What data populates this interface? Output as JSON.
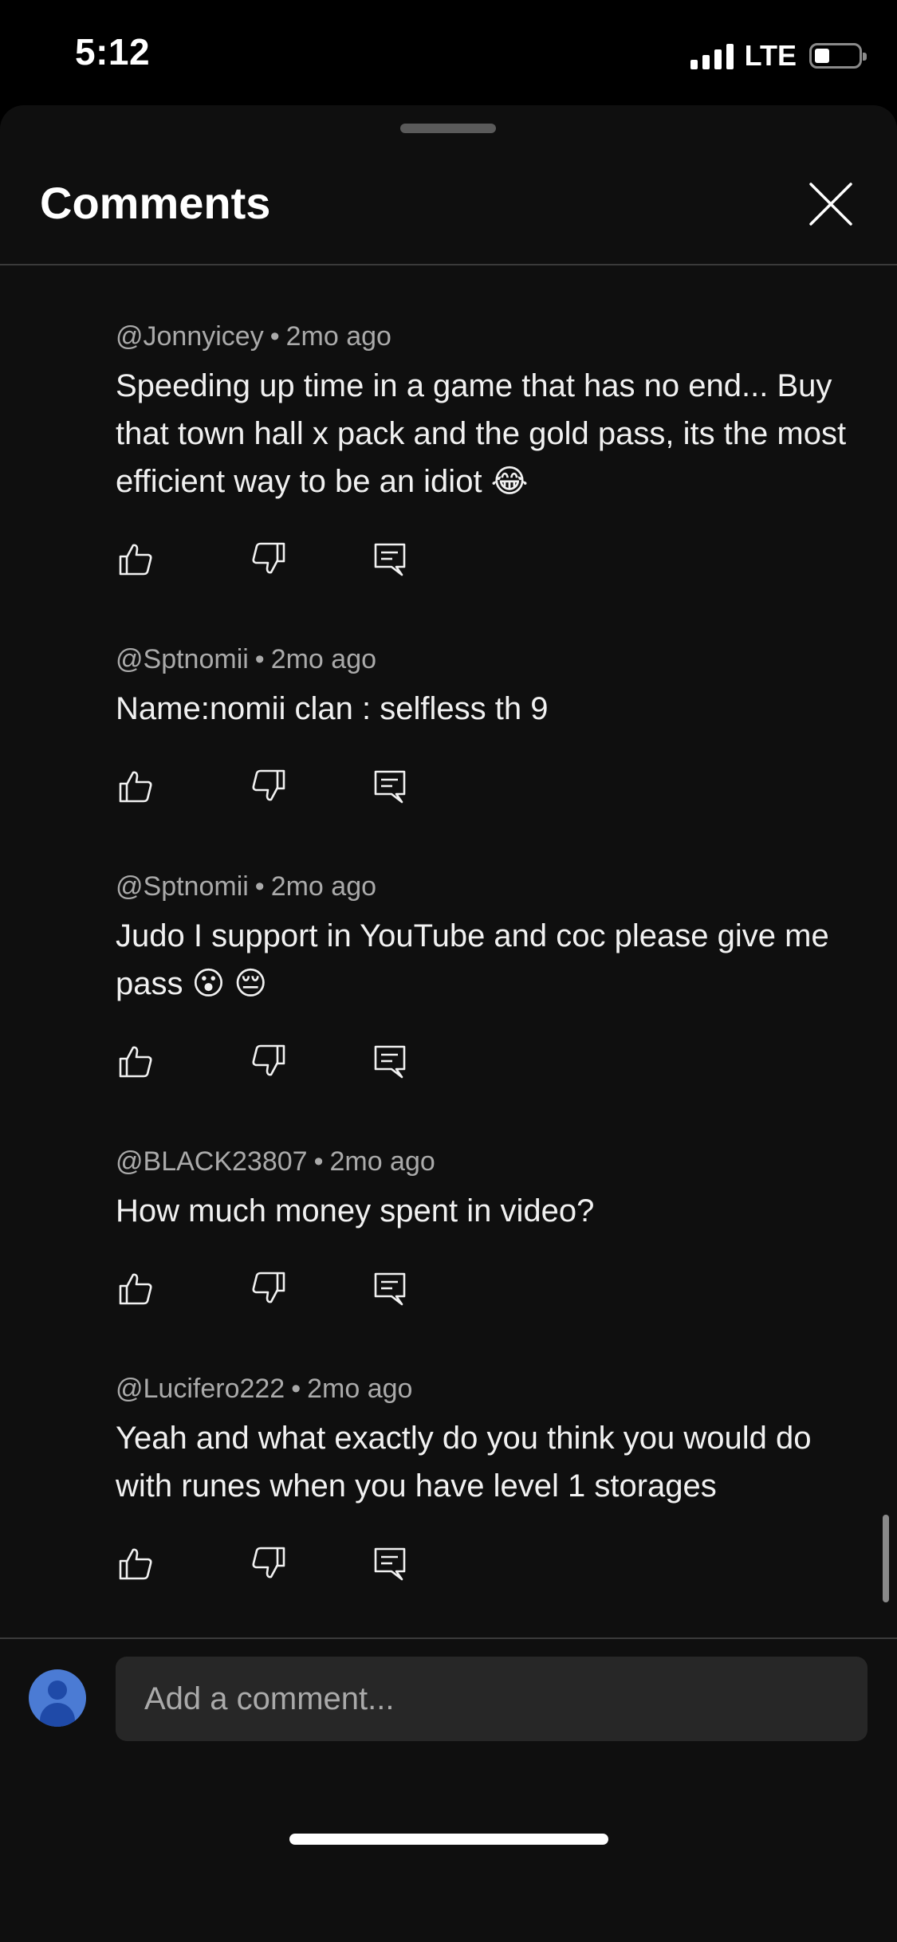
{
  "status_bar": {
    "time": "5:12",
    "network": "LTE",
    "battery_level": 0.2
  },
  "sheet": {
    "title": "Comments"
  },
  "comments": [
    {
      "author": "@Jonnyicey",
      "time": "2mo ago",
      "text": "Speeding up time in a game that has no end... Buy that town hall x pack and the gold pass, its the most efficient way to be an idiot 😂"
    },
    {
      "author": "@Sptnomii",
      "time": "2mo ago",
      "text": "Name:nomii clan : selfless th 9"
    },
    {
      "author": "@Sptnomii",
      "time": "2mo ago",
      "text": "Judo I support in YouTube and coc please give me pass 😮 😔"
    },
    {
      "author": "@BLACK23807",
      "time": "2mo ago",
      "text": "How much money spent in video?"
    },
    {
      "author": "@Lucifero222",
      "time": "2mo ago",
      "text": "Yeah and what exactly do you think you would do with runes when you have level 1 storages"
    }
  ],
  "meta_separator": "•",
  "composer": {
    "placeholder": "Add a comment..."
  },
  "icons": {
    "like": "thumbs-up-icon",
    "dislike": "thumbs-down-icon",
    "reply": "reply-icon",
    "close": "close-icon"
  },
  "colors": {
    "sheet_background": "#0f0f0f",
    "input_background": "#272727",
    "avatar": "#4b7bd4",
    "secondary_text": "#aaaaaa"
  }
}
